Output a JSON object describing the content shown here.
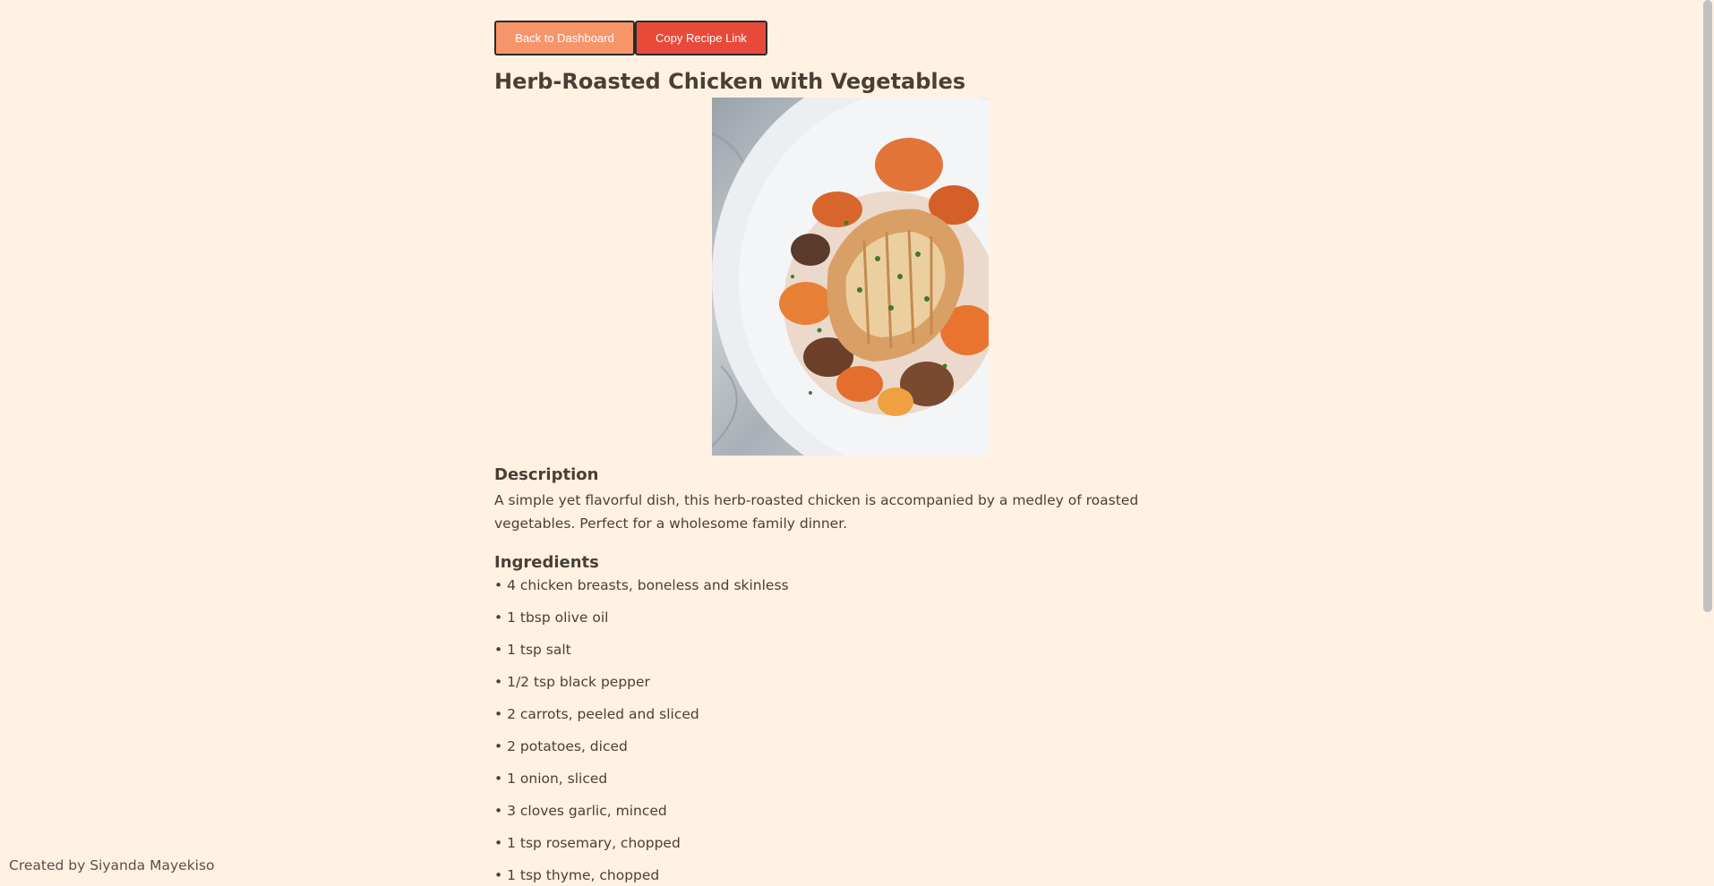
{
  "toolbar": {
    "back_label": "Back to Dashboard",
    "copy_label": "Copy Recipe Link"
  },
  "recipe": {
    "title": "Herb-Roasted Chicken with Vegetables",
    "description_heading": "Description",
    "description": "A simple yet flavorful dish, this herb-roasted chicken is accompanied by a medley of roasted vegetables. Perfect for a wholesome family dinner.",
    "ingredients_heading": "Ingredients",
    "ingredients": [
      "4 chicken breasts, boneless and skinless",
      "1 tbsp olive oil",
      "1 tsp salt",
      "1/2 tsp black pepper",
      "2 carrots, peeled and sliced",
      "2 potatoes, diced",
      "1 onion, sliced",
      "3 cloves garlic, minced",
      "1 tsp rosemary, chopped",
      "1 tsp thyme, chopped"
    ],
    "bullet": "•"
  },
  "footer": {
    "credit": "Created by Siyanda Mayekiso"
  },
  "colors": {
    "background": "#fff2e3",
    "back_button": "#f7956a",
    "copy_button": "#e84a3a",
    "text": "#4a3f35"
  }
}
